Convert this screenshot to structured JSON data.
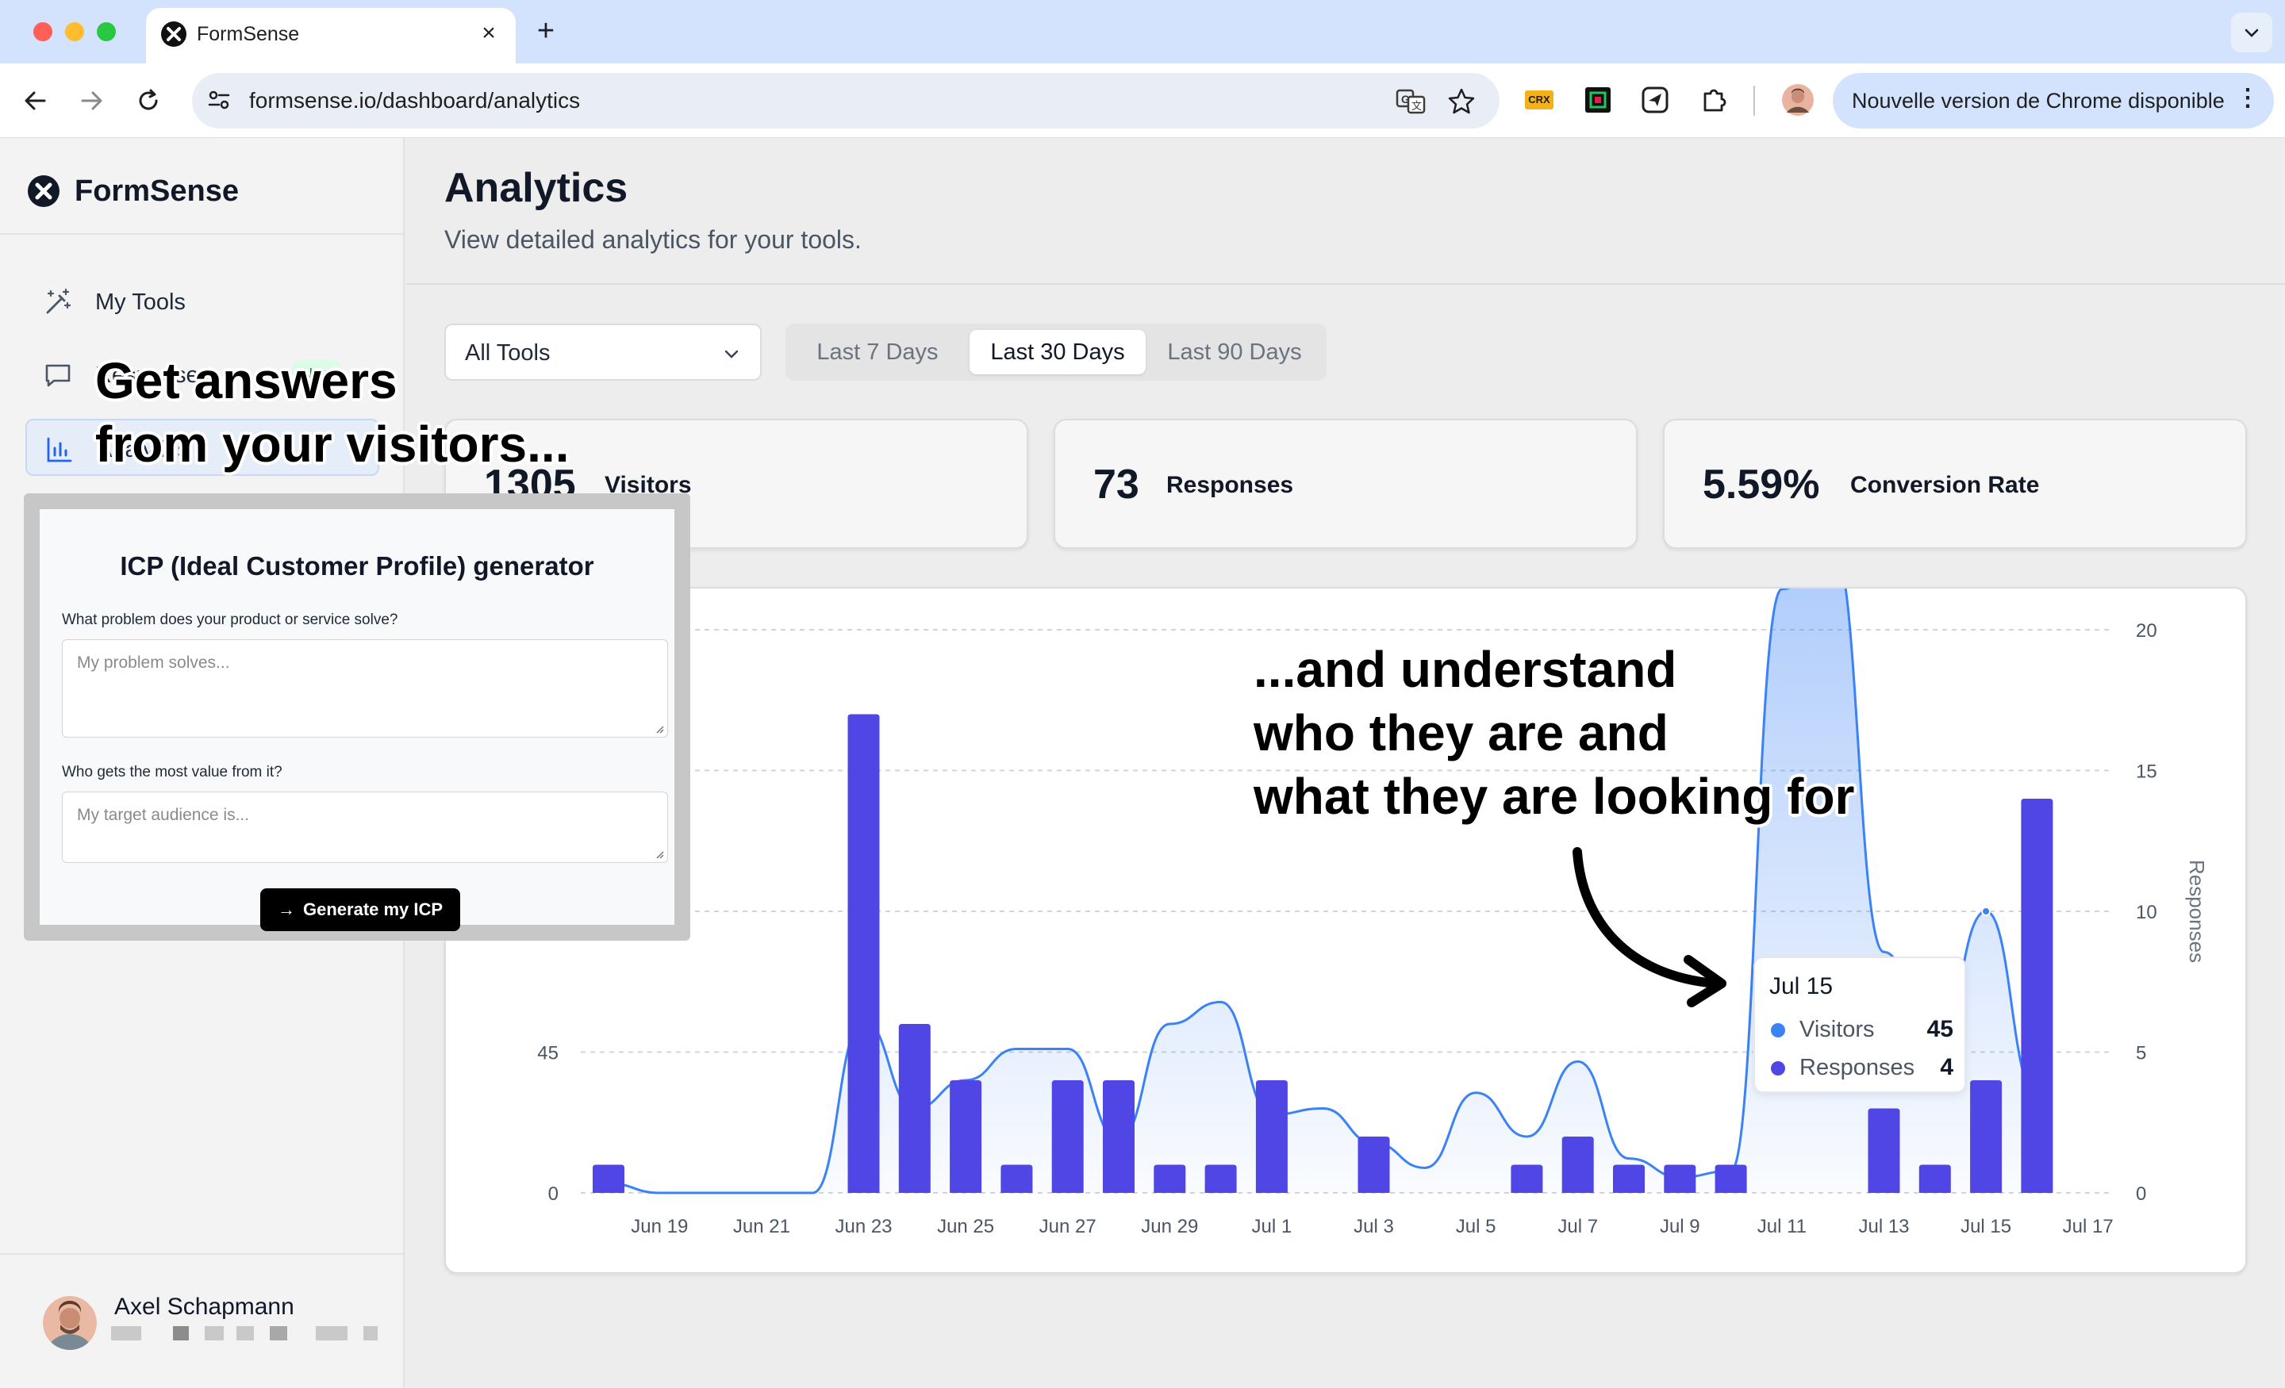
{
  "browser": {
    "tab_title": "FormSense",
    "url": "formsense.io/dashboard/analytics",
    "update_banner": "Nouvelle version de Chrome disponible",
    "extensions": [
      "translate-icon",
      "bookmark-star-icon",
      "crx-extension-icon",
      "color-extension-icon",
      "send-extension-icon",
      "puzzle-extensions-icon",
      "profile-avatar"
    ],
    "crx_label": "CRX"
  },
  "sidebar": {
    "brand": "FormSense",
    "items": [
      {
        "label": "My Tools",
        "icon": "magic-wand-icon",
        "active": false
      },
      {
        "label": "Responses",
        "icon": "chat-bubble-icon",
        "active": false,
        "badge": "New"
      },
      {
        "label": "Analytics",
        "icon": "bar-chart-icon",
        "active": true
      }
    ],
    "user": {
      "name": "Axel Schapmann"
    }
  },
  "page": {
    "title": "Analytics",
    "subtitle": "View detailed analytics for your tools."
  },
  "filters": {
    "tool_select": "All Tools",
    "ranges": [
      "Last 7 Days",
      "Last 30 Days",
      "Last 90 Days"
    ],
    "active_range": "Last 30 Days"
  },
  "stats": [
    {
      "value": "1305",
      "label": "Visitors"
    },
    {
      "value": "73",
      "label": "Responses"
    },
    {
      "value": "5.59%",
      "label": "Conversion Rate"
    }
  ],
  "callouts": {
    "left": [
      "Get answers",
      "from your visitors..."
    ],
    "right": [
      "...and understand",
      "who they are and",
      "what they are looking for"
    ]
  },
  "tooltip": {
    "date": "Jul 15",
    "rows": [
      {
        "name": "Visitors",
        "value": "45",
        "color": "#3b82f6"
      },
      {
        "name": "Responses",
        "value": "4",
        "color": "#4f46e5"
      }
    ]
  },
  "form_preview": {
    "title": "ICP (Ideal Customer Profile) generator",
    "q1": "What problem does your product or service solve?",
    "q1_placeholder": "My problem solves...",
    "q2": "Who gets the most value from it?",
    "q2_placeholder": "My target audience is...",
    "button": "Generate my ICP"
  },
  "chart_data": {
    "type": "bar+area",
    "x": [
      "Jun 18",
      "Jun 19",
      "Jun 20",
      "Jun 21",
      "Jun 22",
      "Jun 23",
      "Jun 24",
      "Jun 25",
      "Jun 26",
      "Jun 27",
      "Jun 28",
      "Jun 29",
      "Jun 30",
      "Jul 1",
      "Jul 2",
      "Jul 3",
      "Jul 4",
      "Jul 5",
      "Jul 6",
      "Jul 7",
      "Jul 8",
      "Jul 9",
      "Jul 10",
      "Jul 11",
      "Jul 12",
      "Jul 13",
      "Jul 14",
      "Jul 15",
      "Jul 16",
      "Jul 17"
    ],
    "x_tick_labels": [
      "Jun 19",
      "Jun 21",
      "Jun 23",
      "Jun 25",
      "Jun 27",
      "Jun 29",
      "Jul 1",
      "Jul 3",
      "Jul 5",
      "Jul 7",
      "Jul 9",
      "Jul 11",
      "Jul 13",
      "Jul 15",
      "Jul 17"
    ],
    "series": [
      {
        "name": "Visitors",
        "axis": "left",
        "type": "area",
        "color": "#3b82f6",
        "values": [
          3,
          0,
          0,
          0,
          0,
          55,
          27,
          36,
          46,
          46,
          17,
          54,
          61,
          25,
          27,
          16,
          8,
          32,
          18,
          42,
          11,
          5,
          7,
          193,
          207,
          77,
          45,
          90,
          31
        ]
      },
      {
        "name": "Responses",
        "axis": "right",
        "type": "bar",
        "color": "#4f46e5",
        "values": [
          1,
          0,
          0,
          0,
          0,
          17,
          6,
          4,
          1,
          4,
          4,
          1,
          1,
          4,
          0,
          2,
          0,
          0,
          1,
          2,
          1,
          1,
          1,
          0,
          0,
          3,
          1,
          4,
          14,
          0
        ]
      }
    ],
    "left_axis": {
      "ticks": [
        0,
        45
      ],
      "max": 180
    },
    "right_axis": {
      "label": "Responses",
      "ticks": [
        0,
        5,
        10,
        15,
        20
      ],
      "max": 20
    },
    "grid": true
  }
}
